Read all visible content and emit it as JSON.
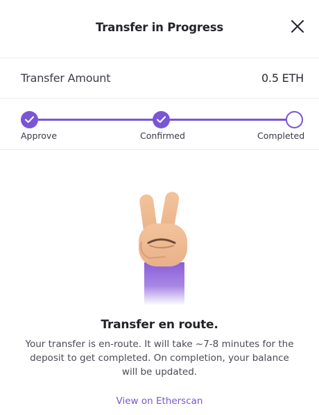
{
  "header": {
    "title": "Transfer in Progress",
    "close_icon": "close-icon"
  },
  "amount": {
    "label": "Transfer Amount",
    "value": "0.5 ETH"
  },
  "stepper": {
    "accent": "#7a55d6",
    "steps": [
      {
        "label": "Approve",
        "status": "done"
      },
      {
        "label": "Confirmed",
        "status": "done"
      },
      {
        "label": "Completed",
        "status": "pending"
      }
    ]
  },
  "illustration": {
    "icon": "victory-hand-icon"
  },
  "message": {
    "title": "Transfer en route.",
    "body": "Your transfer is en-route. It will take ~7-8 minutes for the deposit to get completed. On completion, your balance will be updated."
  },
  "link": {
    "label": "View on Etherscan"
  }
}
